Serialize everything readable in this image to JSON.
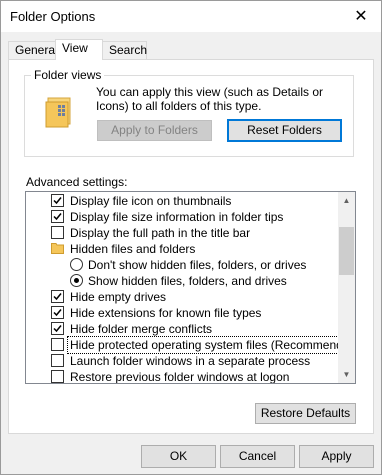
{
  "window": {
    "title": "Folder Options",
    "close_glyph": "✕"
  },
  "tabs": [
    {
      "label": "General"
    },
    {
      "label": "View",
      "active": true
    },
    {
      "label": "Search"
    }
  ],
  "folder_views": {
    "label": "Folder views",
    "description": "You can apply this view (such as Details or Icons) to all folders of this type.",
    "apply_button": "Apply to Folders",
    "reset_button": "Reset Folders"
  },
  "advanced": {
    "label": "Advanced settings:",
    "items": [
      {
        "type": "checkbox",
        "checked": true,
        "level": 1,
        "label": "Display file icon on thumbnails"
      },
      {
        "type": "checkbox",
        "checked": true,
        "level": 1,
        "label": "Display file size information in folder tips"
      },
      {
        "type": "checkbox",
        "checked": false,
        "level": 1,
        "label": "Display the full path in the title bar"
      },
      {
        "type": "folder",
        "level": 1,
        "label": "Hidden files and folders"
      },
      {
        "type": "radio",
        "checked": false,
        "level": 2,
        "label": "Don't show hidden files, folders, or drives"
      },
      {
        "type": "radio",
        "checked": true,
        "level": 2,
        "label": "Show hidden files, folders, and drives"
      },
      {
        "type": "checkbox",
        "checked": true,
        "level": 1,
        "label": "Hide empty drives"
      },
      {
        "type": "checkbox",
        "checked": true,
        "level": 1,
        "label": "Hide extensions for known file types"
      },
      {
        "type": "checkbox",
        "checked": true,
        "level": 1,
        "label": "Hide folder merge conflicts"
      },
      {
        "type": "checkbox",
        "checked": false,
        "level": 1,
        "label": "Hide protected operating system files (Recommended)",
        "selected": true
      },
      {
        "type": "checkbox",
        "checked": false,
        "level": 1,
        "label": "Launch folder windows in a separate process"
      },
      {
        "type": "checkbox",
        "checked": false,
        "level": 1,
        "label": "Restore previous folder windows at logon"
      }
    ],
    "scroll_up_glyph": "▲",
    "scroll_down_glyph": "▼"
  },
  "restore_defaults_button": "Restore Defaults",
  "footer": {
    "ok": "OK",
    "cancel": "Cancel",
    "apply": "Apply"
  },
  "colors": {
    "accent": "#0078d7",
    "folder": "#f5c65a"
  }
}
